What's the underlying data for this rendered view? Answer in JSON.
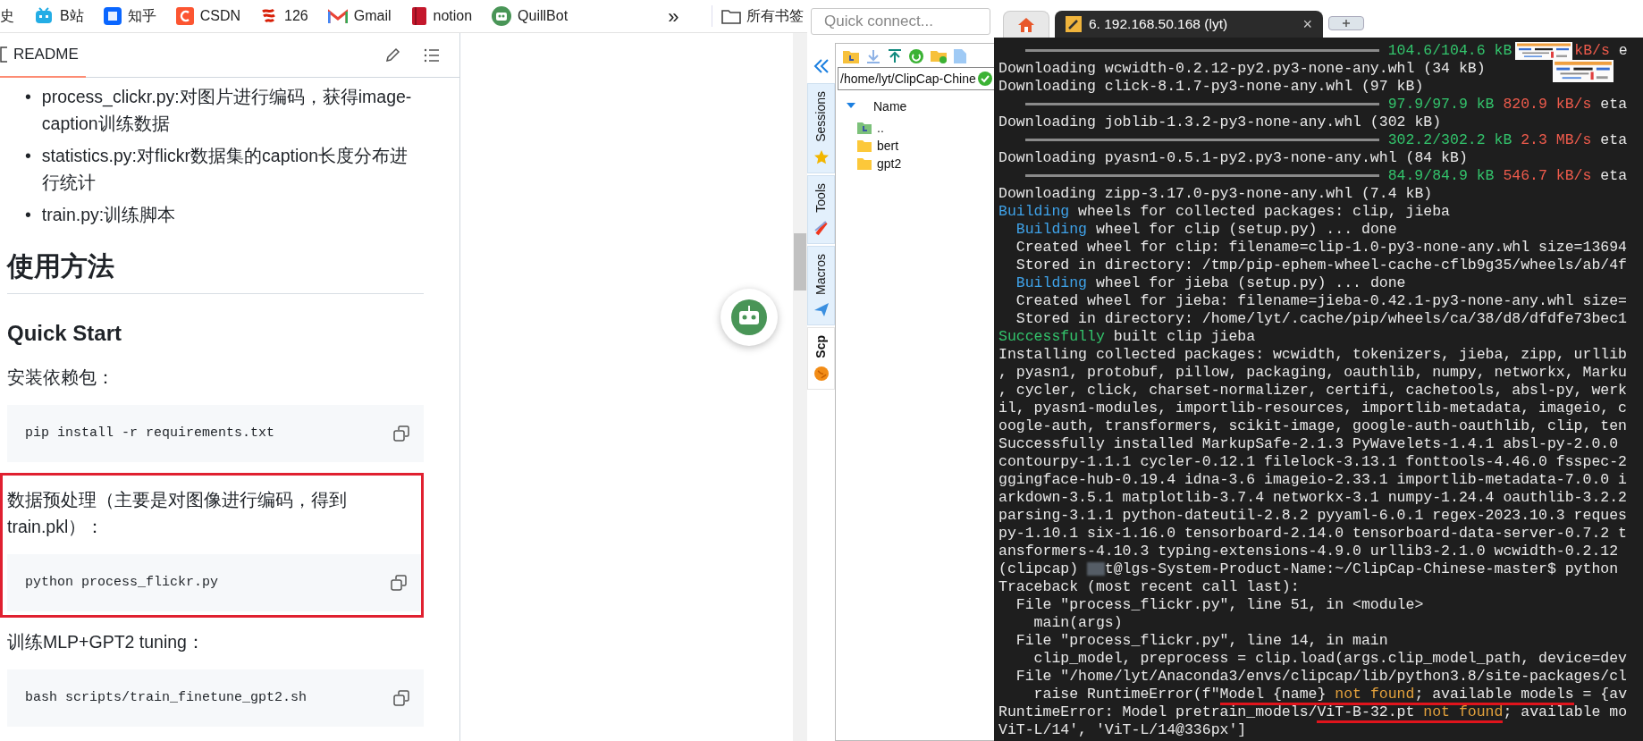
{
  "bookmarks": [
    {
      "label": "史",
      "kind": "text"
    },
    {
      "label": "B站",
      "kind": "site"
    },
    {
      "label": "知乎",
      "kind": "site"
    },
    {
      "label": "CSDN",
      "kind": "site"
    },
    {
      "label": "126",
      "kind": "site"
    },
    {
      "label": "Gmail",
      "kind": "site"
    },
    {
      "label": "notion",
      "kind": "site"
    },
    {
      "label": "QuillBot",
      "kind": "site"
    }
  ],
  "bookmarks_more": "»",
  "all_bookmarks": "所有书签",
  "readme": {
    "tab": {
      "label": "README",
      "selected": true
    },
    "blocks": [
      {
        "kind": "bullets",
        "marker": "•",
        "items": [
          "process_clickr.py:对图片进行编码，获得image-caption训练数据",
          "statistics.py:对flickr数据集的caption长度分布进行统计",
          "train.py:训练脚本"
        ]
      },
      {
        "kind": "h1",
        "text": "使用方法"
      },
      {
        "kind": "h2",
        "text": "Quick Start"
      },
      {
        "kind": "p",
        "text": "安装依赖包："
      },
      {
        "kind": "code",
        "text": "pip install -r requirements.txt"
      },
      {
        "kind": "highlight",
        "children": [
          {
            "kind": "p",
            "text": "数据预处理（主要是对图像进行编码，得到train.pkl）："
          },
          {
            "kind": "code",
            "text": "python process_flickr.py"
          }
        ]
      },
      {
        "kind": "p",
        "text": "训练MLP+GPT2 tuning："
      },
      {
        "kind": "code",
        "text": "bash scripts/train_finetune_gpt2.sh"
      }
    ]
  },
  "moba": {
    "quick_connect": {
      "placeholder": "Quick connect..."
    },
    "side_tabs": [
      {
        "label": "Sessions",
        "selected": false
      },
      {
        "label": "Tools",
        "selected": false
      },
      {
        "label": "Macros",
        "selected": false
      },
      {
        "label": "Scp",
        "selected": true
      }
    ],
    "file_browser": {
      "path": "/home/lyt/ClipCap-Chine",
      "column": "Name",
      "entries": [
        {
          "name": "..",
          "kind": "parent"
        },
        {
          "name": "bert",
          "kind": "folder"
        },
        {
          "name": "gpt2",
          "kind": "folder"
        }
      ]
    },
    "tabs": [
      {
        "kind": "home",
        "selected": false
      },
      {
        "kind": "session",
        "label": "6. 192.168.50.168 (lyt)",
        "close": "×",
        "selected": true
      },
      {
        "kind": "new"
      }
    ]
  },
  "terminal": {
    "thumbnails": [
      {
        "kind": "picture"
      }
    ],
    "lines": [
      [
        {
          "kind": "bar",
          "level": 1
        },
        {
          "text": " 104.6/104.6 kB",
          "color": "#33c46c"
        },
        {
          "kind": "picture"
        },
        {
          "text": "kB/s",
          "color": "#ef5b4c"
        },
        {
          "text": " e"
        }
      ],
      [
        {
          "text": "Downloading wcwidth-0.2.12-py2.py3-none-any.whl (34 kB)"
        }
      ],
      [
        {
          "text": "Downloading click-8.1.7-py3-none-any.whl (97 kB)"
        }
      ],
      [
        {
          "kind": "bar",
          "level": 1
        },
        {
          "text": " 97.9/97.9 kB",
          "color": "#33c46c"
        },
        {
          "text": " 820.9 kB/s",
          "color": "#ef5b4c"
        },
        {
          "text": " eta"
        }
      ],
      [
        {
          "text": "Downloading joblib-1.3.2-py3-none-any.whl (302 kB)"
        }
      ],
      [
        {
          "kind": "bar",
          "level": 1
        },
        {
          "text": " 302.2/302.2 kB",
          "color": "#33c46c"
        },
        {
          "text": " 2.3 MB/s",
          "color": "#ef5b4c"
        },
        {
          "text": " eta"
        }
      ],
      [
        {
          "text": "Downloading pyasn1-0.5.1-py2.py3-none-any.whl (84 kB)"
        }
      ],
      [
        {
          "kind": "bar",
          "level": 1
        },
        {
          "text": " 84.9/84.9 kB",
          "color": "#33c46c"
        },
        {
          "text": " 546.7 kB/s",
          "color": "#ef5b4c"
        },
        {
          "text": " eta"
        }
      ],
      [
        {
          "text": "Downloading zipp-3.17.0-py3-none-any.whl (7.4 kB)"
        }
      ],
      [
        {
          "text": "Building",
          "color": "#3fa3ea"
        },
        {
          "text": " wheels for collected packages: clip, jieba"
        }
      ],
      [
        {
          "text": "  Building",
          "color": "#3fa3ea"
        },
        {
          "text": " wheel for clip (setup.py) ... done"
        }
      ],
      [
        {
          "text": "  Created wheel for clip: filename=clip-1.0-py3-none-any.whl size=13694"
        }
      ],
      [
        {
          "text": "  Stored in directory: /tmp/pip-ephem-wheel-cache-cflb9g35/wheels/ab/4f"
        }
      ],
      [
        {
          "text": "  Building",
          "color": "#3fa3ea"
        },
        {
          "text": " wheel for jieba (setup.py) ... done"
        }
      ],
      [
        {
          "text": "  Created wheel for jieba: filename=jieba-0.42.1-py3-none-any.whl size="
        }
      ],
      [
        {
          "text": "  Stored in directory: /home/lyt/.cache/pip/wheels/ca/38/d8/dfdfe73bec1"
        }
      ],
      [
        {
          "text": "Successfully",
          "color": "#33c46c"
        },
        {
          "text": " built clip jieba"
        }
      ],
      [
        {
          "text": "Installing collected packages: wcwidth, tokenizers, jieba, zipp, urllib"
        }
      ],
      [
        {
          "text": ", pyasn1, protobuf, pillow, packaging, oauthlib, numpy, networkx, Marku"
        }
      ],
      [
        {
          "text": ", cycler, click, charset-normalizer, certifi, cachetools, absl-py, werk"
        }
      ],
      [
        {
          "text": "il, pyasn1-modules, importlib-resources, importlib-metadata, imageio, c"
        }
      ],
      [
        {
          "text": "oogle-auth, transformers, scikit-image, google-auth-oauthlib, clip, ten"
        }
      ],
      [
        {
          "text": "Successfully installed MarkupSafe-2.1.3 PyWavelets-1.4.1 absl-py-2.0.0"
        }
      ],
      [
        {
          "text": "contourpy-1.1.1 cycler-0.12.1 filelock-3.13.1 fonttools-4.46.0 fsspec-2"
        }
      ],
      [
        {
          "text": "ggingface-hub-0.19.4 idna-3.6 imageio-2.33.1 importlib-metadata-7.0.0 i"
        }
      ],
      [
        {
          "text": "arkdown-3.5.1 matplotlib-3.7.4 networkx-3.1 numpy-1.24.4 oauthlib-3.2.2"
        }
      ],
      [
        {
          "text": "parsing-3.1.1 python-dateutil-2.8.2 pyyaml-6.0.1 regex-2023.10.3 reques"
        }
      ],
      [
        {
          "text": "py-1.10.1 six-1.16.0 tensorboard-2.14.0 tensorboard-data-server-0.7.2 t"
        }
      ],
      [
        {
          "text": "ansformers-4.10.3 typing-extensions-4.9.0 urllib3-2.1.0 wcwidth-0.2.12"
        }
      ],
      [
        {
          "text": "(clipcap) "
        },
        {
          "kind": "redacted"
        },
        {
          "text": "t@lgs-System-Product-Name:~/ClipCap-Chinese-master$ python"
        }
      ],
      [
        {
          "text": "Traceback (most recent call last):"
        }
      ],
      [
        {
          "text": "  File \"process_flickr.py\", line 51, in <module>"
        }
      ],
      [
        {
          "text": "    main(args)"
        }
      ],
      [
        {
          "text": "  File \"process_flickr.py\", line 14, in main"
        }
      ],
      [
        {
          "text": "    clip_model, preprocess = clip.load(args.clip_model_path, device=dev"
        }
      ],
      [
        {
          "text": "  File \"/home/lyt/Anaconda3/envs/clipcap/lib/python3.8/site-packages/cl"
        }
      ],
      [
        {
          "text": "    raise RuntimeError(f\""
        },
        {
          "text": "Model {name} ",
          "underlined": true
        },
        {
          "text": "not found",
          "color": "#e3a13c",
          "underlined": true
        },
        {
          "text": "; available models",
          "underlined": true
        },
        {
          "text": " = {av"
        }
      ],
      [
        {
          "text": "RuntimeError: Model pretrain_models/"
        },
        {
          "text": "ViT-B-32.pt ",
          "underlined": true
        },
        {
          "text": "not found",
          "color": "#e3a13c",
          "underlined": true
        },
        {
          "text": "; available mo"
        }
      ],
      [
        {
          "text": "ViT-L/14', 'ViT-L/14@336px']"
        }
      ]
    ]
  }
}
